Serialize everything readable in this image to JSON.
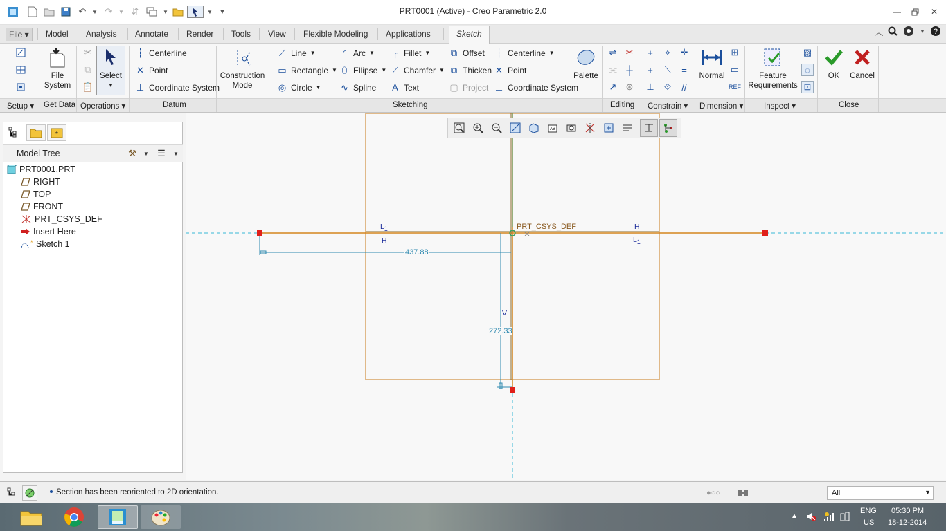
{
  "window": {
    "title": "PRT0001 (Active) - Creo Parametric 2.0"
  },
  "ribbon_tabs": [
    "File",
    "Model",
    "Analysis",
    "Annotate",
    "Render",
    "Tools",
    "View",
    "Flexible Modeling",
    "Applications",
    "Sketch"
  ],
  "ribbon": {
    "get_data": {
      "file_system": "File\nSystem"
    },
    "operations": {
      "select": "Select"
    },
    "datum": {
      "centerline": "Centerline",
      "point": "Point",
      "coordinate_system": "Coordinate System"
    },
    "sketching": {
      "construction_mode": "Construction\nMode",
      "line": "Line",
      "rectangle": "Rectangle",
      "circle": "Circle",
      "arc": "Arc",
      "ellipse": "Ellipse",
      "spline": "Spline",
      "fillet": "Fillet",
      "chamfer": "Chamfer",
      "text": "Text",
      "offset": "Offset",
      "thicken": "Thicken",
      "project": "Project",
      "centerline": "Centerline",
      "point": "Point",
      "coordinate_system": "Coordinate System",
      "palette": "Palette"
    },
    "dimension": {
      "normal": "Normal"
    },
    "inspect": {
      "feature_requirements": "Feature\nRequirements"
    },
    "close": {
      "ok": "OK",
      "cancel": "Cancel"
    }
  },
  "groups": [
    "Setup",
    "Get Data",
    "Operations",
    "Datum",
    "Sketching",
    "Editing",
    "Constrain",
    "Dimension",
    "Inspect",
    "Close"
  ],
  "model_tree": {
    "title": "Model Tree",
    "items": [
      {
        "label": "PRT0001.PRT",
        "icon": "part-icon"
      },
      {
        "label": "RIGHT",
        "icon": "datum-plane-icon"
      },
      {
        "label": "TOP",
        "icon": "datum-plane-icon"
      },
      {
        "label": "FRONT",
        "icon": "datum-plane-icon"
      },
      {
        "label": "PRT_CSYS_DEF",
        "icon": "csys-icon"
      },
      {
        "label": "Insert Here",
        "icon": "insert-arrow-icon"
      },
      {
        "label": "Sketch 1",
        "icon": "sketch-icon"
      }
    ]
  },
  "sketch": {
    "csys_label": "PRT_CSYS_DEF",
    "horizontal_dimension": "437.88",
    "vertical_dimension": "272.33",
    "constraint_h": "H",
    "constraint_v": "V",
    "constraint_l": "L",
    "constraint_l_index": "1"
  },
  "status": {
    "message": "Section has been reoriented to 2D orientation.",
    "filter": "All"
  },
  "taskbar": {
    "language": "ENG",
    "region": "US",
    "time": "05:30 PM",
    "date": "18-12-2014"
  },
  "colors": {
    "accent": "#1b4f9c",
    "sketch_line": "#c77a1a",
    "dimension": "#2f8ab0",
    "handle": "#e0201a",
    "ok_green": "#2a9a2a",
    "cancel_red": "#c02020"
  }
}
